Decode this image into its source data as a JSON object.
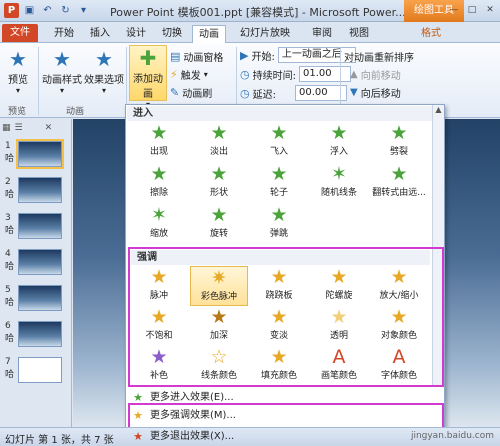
{
  "window": {
    "title": "Power Point  模板001.ppt [兼容模式] - Microsoft Power...",
    "context_tab": "绘图工具",
    "minimize": "—",
    "maximize": "□",
    "close": "✕"
  },
  "tabs": [
    "文件",
    "开始",
    "插入",
    "设计",
    "切换",
    "动画",
    "幻灯片放映",
    "审阅",
    "视图",
    "格式"
  ],
  "ribbon": {
    "preview_label": "预览",
    "preview_group": "预览",
    "anim_style_label": "动画样式",
    "effect_options_label": "效果选项",
    "anim_group": "动画",
    "add_anim_label": "添加动画",
    "anim_pane_label": "动画窗格",
    "trigger_label": "触发",
    "anim_painter_label": "动画刷",
    "start_label": "开始:",
    "start_value": "上一动画之后",
    "duration_label": "持续时间:",
    "duration_value": "01.00",
    "delay_label": "延迟:",
    "delay_value": "00.00",
    "reorder_label": "对动画重新排序",
    "move_earlier_label": "向前移动",
    "move_later_label": "向后移动"
  },
  "slides_panel": {
    "slide_prefix": "哈",
    "numbers": [
      "1",
      "2",
      "3",
      "4",
      "5",
      "6",
      "7"
    ]
  },
  "gallery": {
    "entrance_header": "进入",
    "entrance_items": [
      "出现",
      "淡出",
      "飞入",
      "浮入",
      "劈裂",
      "擦除",
      "形状",
      "轮子",
      "随机线条",
      "翻转式由远...",
      "缩放",
      "旋转",
      "弹跳"
    ],
    "emphasis_header": "强调",
    "emphasis_items": [
      "脉冲",
      "彩色脉冲",
      "跷跷板",
      "陀螺旋",
      "放大/缩小",
      "不饱和",
      "加深",
      "变淡",
      "透明",
      "对象颜色",
      "补色",
      "线条颜色",
      "填充颜色",
      "画笔颜色",
      "字体颜色"
    ],
    "selected_item": "彩色脉冲",
    "more_entrance": "更多进入效果(E)...",
    "more_emphasis": "更多强调效果(M)...",
    "more_exit": "更多退出效果(X)..."
  },
  "statusbar": {
    "left": "幻灯片 第 1 张，共 7 张",
    "watermark": "jingyan.baidu.com"
  },
  "colors": {
    "accent": "#2e75b6",
    "file_tab": "#d24726",
    "highlight": "#d23ad0",
    "context_tab": "#e2791c"
  }
}
